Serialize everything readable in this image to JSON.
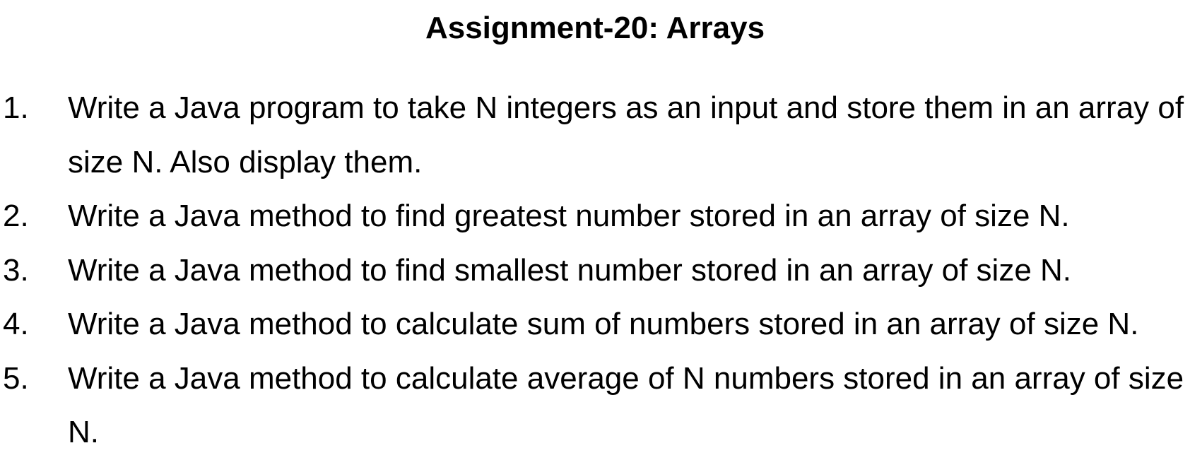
{
  "document": {
    "title": "Assignment-20: Arrays",
    "items": [
      {
        "number": "1.",
        "text": "Write a Java program to take N integers as an input and store them in an array of size N. Also display them."
      },
      {
        "number": "2.",
        "text": "Write a Java method to find greatest number stored in an array of size N."
      },
      {
        "number": "3.",
        "text": "Write a Java method to find smallest number stored in an array of size N."
      },
      {
        "number": "4.",
        "text": "Write a Java method to calculate sum of numbers stored in an array of size N."
      },
      {
        "number": "5.",
        "text": "Write a Java method to calculate average of N numbers stored in an array of size N."
      }
    ]
  }
}
